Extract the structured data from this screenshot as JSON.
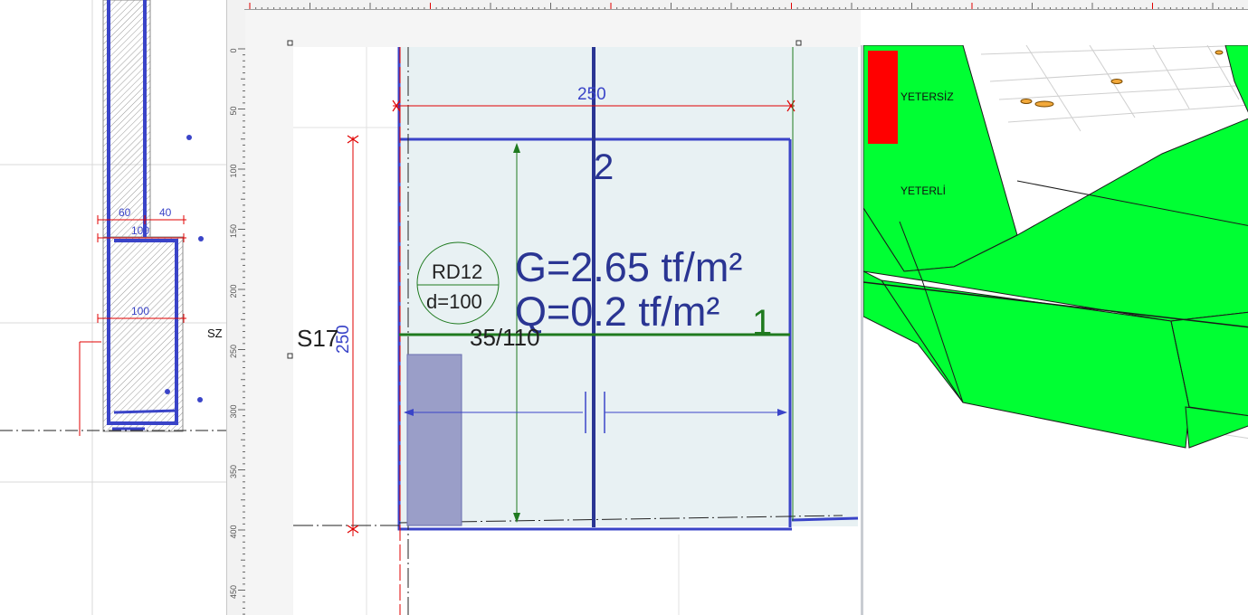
{
  "left_detail": {
    "dim_60": "60",
    "dim_40": "40",
    "dim_100_top": "100",
    "dim_100_mid": "100",
    "section_mark": "SZ"
  },
  "ruler": {
    "vertical_ticks": [
      "0",
      "50",
      "100",
      "150",
      "200",
      "250",
      "300",
      "350",
      "400",
      "450"
    ]
  },
  "slab": {
    "dim_top": "250",
    "dim_left": "250",
    "axis_label": "2",
    "rebar_top": "RD12",
    "rebar_bottom": "d=100",
    "load_g": "G=2.65 tf/m²",
    "load_q": "Q=0.2 tf/m²",
    "panel_number": "1",
    "beam_label": "35/110",
    "column_label": "S17"
  },
  "view3d": {
    "label_insufficient": "YETERSİZ",
    "label_sufficient": "YETERLİ",
    "colors": {
      "insufficient": "#ff0000",
      "sufficient": "#00ff33"
    }
  },
  "colors": {
    "rebar_blue": "#3a44c8",
    "dim_red": "#e00000",
    "beam_green": "#1f7a1f",
    "slab_fill": "#e8f1f3"
  }
}
